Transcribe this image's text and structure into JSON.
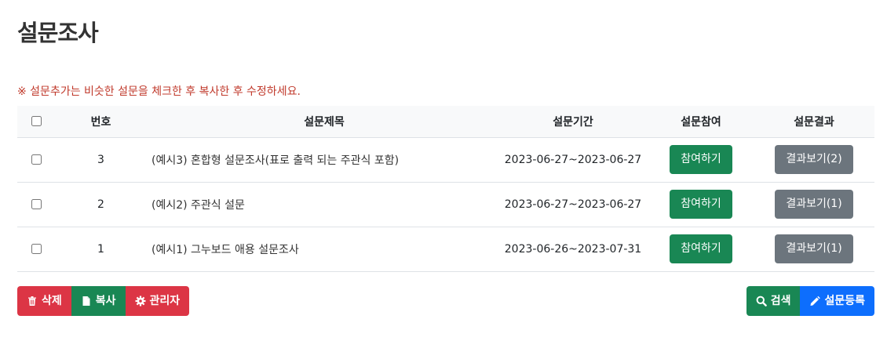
{
  "page": {
    "title": "설문조사",
    "notice": "※ 설문추가는 비슷한 설문을 체크한 후 복사한 후 수정하세요."
  },
  "table": {
    "headers": {
      "number": "번호",
      "title": "설문제목",
      "period": "설문기간",
      "join": "설문참여",
      "result": "설문결과"
    },
    "rows": [
      {
        "number": "3",
        "title": "(예시3) 혼합형 설문조사(표로 출력 되는 주관식 포함)",
        "period": "2023-06-27~2023-06-27",
        "join": "참여하기",
        "result": "결과보기(2)"
      },
      {
        "number": "2",
        "title": "(예시2) 주관식 설문",
        "period": "2023-06-27~2023-06-27",
        "join": "참여하기",
        "result": "결과보기(1)"
      },
      {
        "number": "1",
        "title": "(예시1) 그누보드 애용 설문조사",
        "period": "2023-06-26~2023-07-31",
        "join": "참여하기",
        "result": "결과보기(1)"
      }
    ]
  },
  "toolbar": {
    "delete_label": "삭제",
    "copy_label": "복사",
    "admin_label": "관리자",
    "search_label": "검색",
    "register_label": "설문등록"
  },
  "icons": {
    "delete": "trash-icon",
    "copy": "file-icon",
    "admin": "gear-icon",
    "search": "search-icon",
    "register": "pencil-icon"
  },
  "colors": {
    "success": "#198754",
    "secondary": "#6c757d",
    "danger": "#dc3545",
    "primary": "#0d6efd",
    "notice": "#c0392b"
  }
}
